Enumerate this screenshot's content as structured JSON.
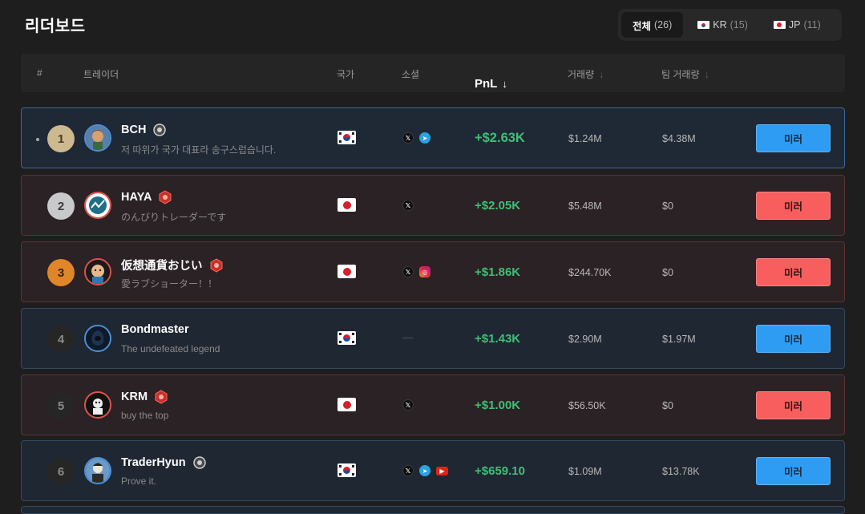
{
  "page": {
    "title": "리더보드"
  },
  "filters": [
    {
      "label": "전체",
      "count": "(26)",
      "active": true
    },
    {
      "label": "KR",
      "count": "(15)",
      "flag": "kr"
    },
    {
      "label": "JP",
      "count": "(11)",
      "flag": "jp"
    }
  ],
  "columns": {
    "rank": "#",
    "trader": "트레이더",
    "country": "국가",
    "social": "소셜",
    "pnl": "PnL",
    "pnl_arrow": "↓",
    "volume": "거래량",
    "volume_arrow": "↓",
    "team_volume": "팀 거래량",
    "team_arrow": "↓"
  },
  "rows": [
    {
      "rank": "1",
      "name": "BCH",
      "bio": "저 따위가 국가 대표라 송구스럽습니다.",
      "pnl": "+$2.63K",
      "volume": "$1.24M",
      "team_volume": "$4.38M",
      "button": "미러",
      "social_empty": ""
    },
    {
      "rank": "2",
      "name": "HAYA",
      "bio": "のんびりトレーダーです",
      "pnl": "+$2.05K",
      "volume": "$5.48M",
      "team_volume": "$0",
      "button": "미러",
      "social_empty": ""
    },
    {
      "rank": "3",
      "name": "仮想通貨おじい",
      "bio": "愛ラブショーター！！",
      "pnl": "+$1.86K",
      "volume": "$244.70K",
      "team_volume": "$0",
      "button": "미러",
      "social_empty": ""
    },
    {
      "rank": "4",
      "name": "Bondmaster",
      "bio": "The undefeated legend",
      "pnl": "+$1.43K",
      "volume": "$2.90M",
      "team_volume": "$1.97M",
      "button": "미러",
      "social_empty": "—"
    },
    {
      "rank": "5",
      "name": "KRM",
      "bio": "buy the top",
      "pnl": "+$1.00K",
      "volume": "$56.50K",
      "team_volume": "$0",
      "button": "미러",
      "social_empty": ""
    },
    {
      "rank": "6",
      "name": "TraderHyun",
      "bio": "Prove it.",
      "pnl": "+$659.10",
      "volume": "$1.09M",
      "team_volume": "$13.78K",
      "button": "미러",
      "social_empty": ""
    }
  ],
  "colors": {
    "accent_blue": "#2f9cf4",
    "accent_red": "#f95e5e",
    "pnl_green": "#3fbf76"
  },
  "icons": {
    "x": "x-icon",
    "telegram": "telegram-icon",
    "instagram": "instagram-icon",
    "youtube": "youtube-icon"
  }
}
